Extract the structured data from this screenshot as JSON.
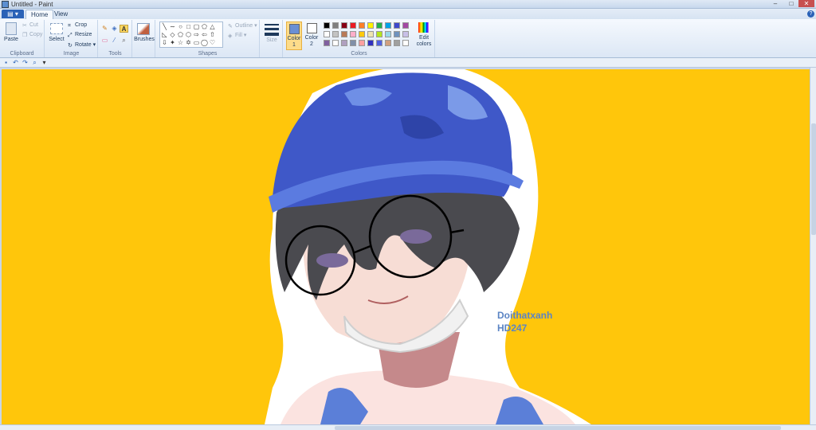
{
  "window": {
    "title": "Untitled - Paint"
  },
  "tabs": {
    "file_icon": "menu-icon",
    "home": "Home",
    "view": "View"
  },
  "clipboard": {
    "paste": "Paste",
    "cut": "Cut",
    "copy": "Copy",
    "label": "Clipboard"
  },
  "image": {
    "select": "Select",
    "crop": "Crop",
    "resize": "Resize",
    "rotate": "Rotate",
    "label": "Image"
  },
  "tools": {
    "label": "Tools",
    "text_tool": "A"
  },
  "brushes": {
    "label": "Brushes"
  },
  "shapes": {
    "outline": "Outline",
    "fill": "Fill",
    "label": "Shapes"
  },
  "size": {
    "label": "Size"
  },
  "colors": {
    "color1_label": "Color",
    "color1_num": "1",
    "color2_label": "Color",
    "color2_num": "2",
    "edit_label": "Edit",
    "edit_label2": "colors",
    "label": "Colors",
    "color1_value": "#6b8fd3",
    "color2_value": "#ffffff",
    "palette_row1": [
      "#000000",
      "#7f7f7f",
      "#880015",
      "#ed1c24",
      "#ff7f27",
      "#fff200",
      "#22b14c",
      "#00a2e8",
      "#3f48cc",
      "#a349a4"
    ],
    "palette_row2": [
      "#ffffff",
      "#c3c3c3",
      "#b97a57",
      "#ffaec9",
      "#ffc90e",
      "#efe4b0",
      "#b5e61d",
      "#99d9ea",
      "#7092be",
      "#c8bfe7"
    ],
    "palette_row3": [
      "#8060a0",
      "#ffffff",
      "#b0a0c0",
      "#8090a8",
      "#ffa0a0",
      "#3030c0",
      "#5060e0",
      "#d0a080",
      "#a0a0a0",
      "#ffffff"
    ]
  },
  "canvas": {
    "background": "#ffc60b",
    "watermark_line1": "Doithatxanh",
    "watermark_line2": "HD247"
  }
}
